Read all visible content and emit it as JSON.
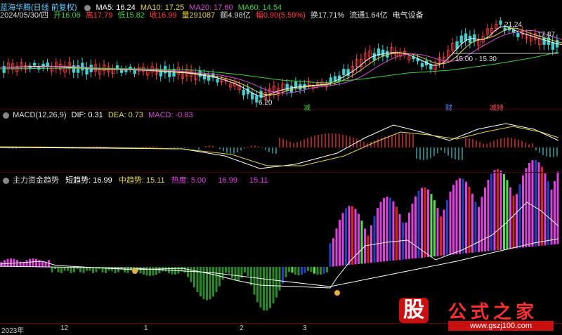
{
  "header": {
    "title": "蓝海华腾(日线 前复权)",
    "ma": [
      {
        "label": "MA5: 16.24",
        "color": "#ffffff"
      },
      {
        "label": "MA10: 17.25",
        "color": "#e6d24b"
      },
      {
        "label": "MA20: 17.60",
        "color": "#d050d0"
      },
      {
        "label": "MA60: 14.54",
        "color": "#40d040"
      }
    ]
  },
  "quote": {
    "date": "2024/05/30/四",
    "open": "开16.06",
    "high": "高17.79",
    "low": "低15.82",
    "close": "收16.99",
    "volume": "量291087",
    "amount": "额4.98亿",
    "change": "幅0.90(5.59%)",
    "turnover": "换17.71%",
    "float_cap": "流通1.64亿",
    "sector": "电气设备"
  },
  "main_chart": {
    "labels": {
      "high_mark": "21.24",
      "right_mark": "17.87",
      "low_mark": "6.20",
      "range_box": "15.00 - 15.30",
      "event1": "减",
      "event2": "财",
      "event3": "减持"
    }
  },
  "macd": {
    "title": "MACD(12,26,9)",
    "dif": "DIF: 0.31",
    "dea": "DEA: 0.73",
    "macd": "MACD: -0.83"
  },
  "trend": {
    "title": "主力资金趋势",
    "short": "短趋势: 16.99",
    "mid": "中趋势: 15.11",
    "hot": "热度: 5.00",
    "v1": "16.99",
    "v2": "15.11"
  },
  "axis": {
    "year": "2023年",
    "ticks": [
      "12",
      "1",
      "2",
      "3"
    ]
  },
  "watermark": {
    "logo": "股",
    "brand": "公式之家",
    "url": "www.gszj100.com"
  },
  "colors": {
    "up": "#ff4040",
    "down": "#40d0d0",
    "ma5": "#ffffff",
    "ma10": "#e6d24b",
    "ma20": "#d050d0",
    "ma60": "#40d040",
    "magenta": "#e040e0",
    "green": "#2a8a2a",
    "blue": "#2040c0",
    "brightgreen": "#50e050"
  }
}
